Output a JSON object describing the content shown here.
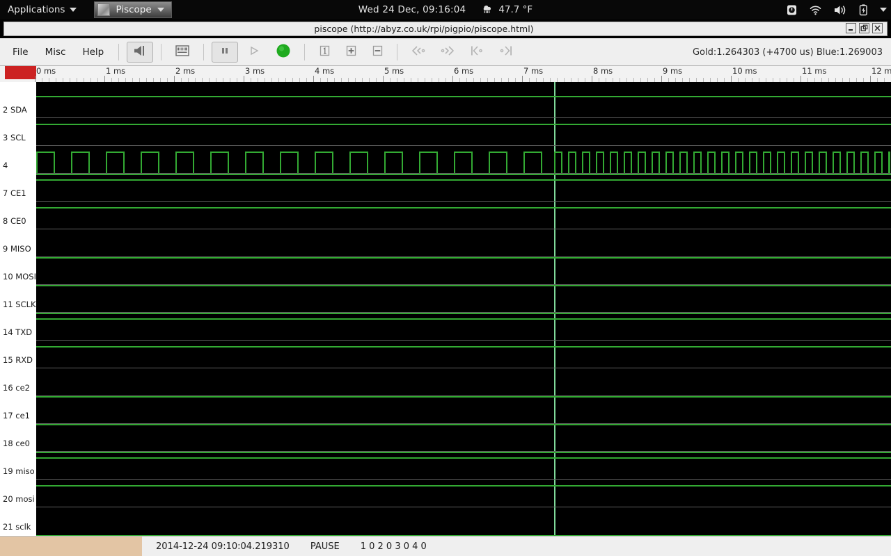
{
  "taskbar": {
    "applications_label": "Applications",
    "task_label": "Piscope",
    "clock": "Wed 24 Dec, 09:16:04",
    "weather_temp": "47.7 °F",
    "weather_icon": "rain-cloud-icon",
    "tray": [
      {
        "name": "brightness-icon"
      },
      {
        "name": "wifi-icon"
      },
      {
        "name": "volume-icon"
      },
      {
        "name": "battery-icon"
      },
      {
        "name": "tray-chevron-down-icon"
      }
    ]
  },
  "window": {
    "title": "piscope (http://abyz.co.uk/rpi/pigpio/piscope.html)",
    "buttons": [
      {
        "name": "minimize-button",
        "glyph": "—"
      },
      {
        "name": "maximize-button",
        "glyph": "❐"
      },
      {
        "name": "close-button",
        "glyph": "✕"
      }
    ]
  },
  "toolbar": {
    "menus": [
      {
        "name": "menu-file",
        "label": "File"
      },
      {
        "name": "menu-misc",
        "label": "Misc"
      },
      {
        "name": "menu-help",
        "label": "Help"
      }
    ],
    "buttons": [
      {
        "name": "trigger-button",
        "icon": "trigger-icon",
        "pressed": true
      },
      {
        "name": "decode-button",
        "icon": "decode-icon",
        "pressed": false
      },
      {
        "name": "pause-button",
        "icon": "pause-icon",
        "pressed": true
      },
      {
        "name": "play-button",
        "icon": "play-icon",
        "pressed": false
      },
      {
        "name": "record-button",
        "icon": "record-led-icon",
        "pressed": false
      },
      {
        "name": "zoom-reset-button",
        "icon": "zoom-one-icon",
        "pressed": false
      },
      {
        "name": "zoom-in-button",
        "icon": "zoom-in-icon",
        "pressed": false
      },
      {
        "name": "zoom-out-button",
        "icon": "zoom-out-icon",
        "pressed": false
      },
      {
        "name": "step-back-button",
        "icon": "step-back-icon",
        "pressed": false
      },
      {
        "name": "step-forward-button",
        "icon": "step-forward-icon",
        "pressed": false
      },
      {
        "name": "goto-start-button",
        "icon": "goto-start-icon",
        "pressed": false
      },
      {
        "name": "goto-end-button",
        "icon": "goto-end-icon",
        "pressed": false
      }
    ],
    "readout": "Gold:1.264303 (+4700 us)  Blue:1.269003",
    "gold_cursor": "Gold:1.264303",
    "delta": "(+4700 us)",
    "blue_cursor": "Blue:1.269003"
  },
  "ruler": {
    "unit": "ms",
    "labels": [
      "0 ms",
      "1 ms",
      "2 ms",
      "3 ms",
      "4 ms",
      "5 ms",
      "6 ms",
      "7 ms",
      "8 ms",
      "9 ms",
      "10 ms",
      "11 ms",
      "12 ms"
    ],
    "minor_per_major": 10,
    "range_ms": [
      0,
      12.25
    ],
    "corner_marker_color": "#cc2222"
  },
  "channels": [
    {
      "name": "channel-2",
      "label": "2 SDA",
      "state": "high"
    },
    {
      "name": "channel-3",
      "label": "3 SCL",
      "state": "high"
    },
    {
      "name": "channel-4",
      "label": "4",
      "state": "pulse-train"
    },
    {
      "name": "channel-7",
      "label": "7 CE1",
      "state": "high"
    },
    {
      "name": "channel-8",
      "label": "8 CE0",
      "state": "high"
    },
    {
      "name": "channel-9",
      "label": "9 MISO",
      "state": "low"
    },
    {
      "name": "channel-10",
      "label": "10 MOSI",
      "state": "low"
    },
    {
      "name": "channel-11",
      "label": "11 SCLK",
      "state": "low"
    },
    {
      "name": "channel-14",
      "label": "14 TXD",
      "state": "high"
    },
    {
      "name": "channel-15",
      "label": "15 RXD",
      "state": "high"
    },
    {
      "name": "channel-16",
      "label": "16 ce2",
      "state": "low"
    },
    {
      "name": "channel-17",
      "label": "17 ce1",
      "state": "low"
    },
    {
      "name": "channel-18",
      "label": "18 ce0",
      "state": "low"
    },
    {
      "name": "channel-19",
      "label": "19 miso",
      "state": "high"
    },
    {
      "name": "channel-20",
      "label": "20 mosi",
      "state": "high"
    },
    {
      "name": "channel-21",
      "label": "21 sclk",
      "state": "low"
    }
  ],
  "waveform": {
    "cursor_ms": 7.44,
    "cursor_color": "#7fd89a",
    "signal_color": "#33aa33",
    "separator_color": "#606060",
    "background_color": "#000000",
    "pulse_train": {
      "channel": "4",
      "segment_1": {
        "start_ms": 0.0,
        "end_ms": 7.44,
        "period_ms": 0.5,
        "duty": 0.5
      },
      "segment_2": {
        "start_ms": 7.44,
        "end_ms": 12.25,
        "period_ms": 0.2,
        "duty": 0.5
      }
    }
  },
  "statusbar": {
    "timestamp": "2014-12-24 09:10:04.219310",
    "mode": "PAUSE",
    "counters": "1 0  2 0  3 0  4 0",
    "swatch_color": "#e3c5a4"
  }
}
